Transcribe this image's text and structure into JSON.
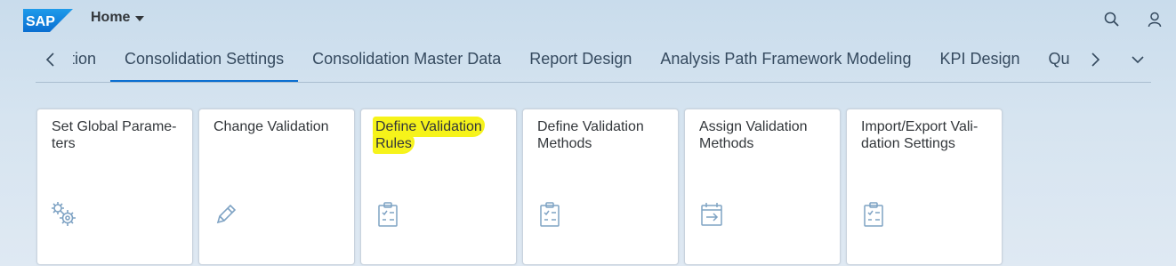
{
  "header": {
    "logo_text": "SAP",
    "home_label": "Home",
    "icons": [
      "search-icon",
      "user-icon"
    ]
  },
  "tabs": [
    {
      "label": "Data Collection",
      "visible": "ection"
    },
    {
      "label": "Consolidation Settings",
      "active": true
    },
    {
      "label": "Consolidation Master Data"
    },
    {
      "label": "Report Design"
    },
    {
      "label": "Analysis Path Framework Modeling"
    },
    {
      "label": "KPI Design"
    },
    {
      "label": "Qu"
    }
  ],
  "tiles": [
    {
      "title": "Set Global Parame-ters",
      "line1": "Set Global Parame-",
      "line2": "ters",
      "icon": "gears-icon"
    },
    {
      "title": "Change Validation",
      "line1": "Change Validation",
      "line2": "",
      "icon": "pencil-icon"
    },
    {
      "title": "Define Validation Rules",
      "line1": "Define Validation",
      "line2": "Rules",
      "icon": "checklist-icon",
      "highlighted": true
    },
    {
      "title": "Define Validation Methods",
      "line1": "Define Validation",
      "line2": "Methods",
      "icon": "checklist-icon"
    },
    {
      "title": "Assign Validation Methods",
      "line1": "Assign Validation",
      "line2": "Methods",
      "icon": "assign-icon"
    },
    {
      "title": "Import/Export Vali-dation Settings",
      "line1": "Import/Export Vali-",
      "line2": "dation Settings",
      "icon": "checklist-icon"
    }
  ],
  "colors": {
    "accent": "#0a6ed1",
    "icon": "#7fa3c4",
    "highlight": "#f6f31a"
  }
}
